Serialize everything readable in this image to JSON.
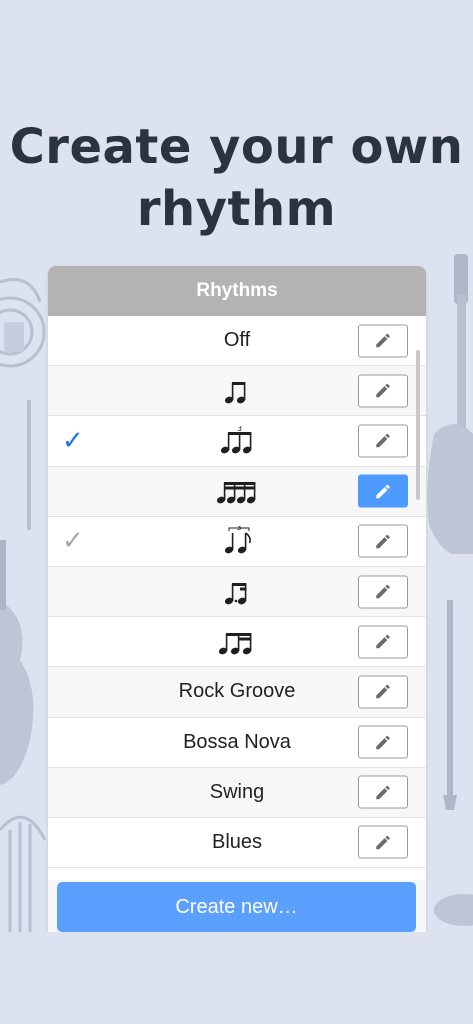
{
  "headline": "Create your own rhythm",
  "panel": {
    "title": "Rhythms"
  },
  "rhythms": [
    {
      "label": "Off",
      "icon": "none",
      "check": "",
      "edit_active": false
    },
    {
      "label": "",
      "icon": "two-eighth-notes",
      "check": "",
      "edit_active": false
    },
    {
      "label": "",
      "icon": "eighth-triplet",
      "check": "✓",
      "check_color": "#1a73e8",
      "edit_active": false
    },
    {
      "label": "",
      "icon": "four-sixteenth-notes",
      "check": "",
      "edit_active": true
    },
    {
      "label": "",
      "icon": "quarter-eighth-triplet",
      "check": "✓",
      "check_color": "#a8a8a8",
      "edit_active": false
    },
    {
      "label": "",
      "icon": "dotted-eighth-sixteenth",
      "check": "",
      "edit_active": false
    },
    {
      "label": "",
      "icon": "eighth-two-sixteenths",
      "check": "",
      "edit_active": false
    },
    {
      "label": "Rock Groove",
      "icon": "none",
      "check": "",
      "edit_active": false
    },
    {
      "label": "Bossa Nova",
      "icon": "none",
      "check": "",
      "edit_active": false
    },
    {
      "label": "Swing",
      "icon": "none",
      "check": "",
      "edit_active": false
    },
    {
      "label": "Blues",
      "icon": "none",
      "check": "",
      "edit_active": false
    }
  ],
  "triplet_number": "3",
  "create_button": "Create new…",
  "colors": {
    "background": "#dde2f0",
    "accent": "#5ba0ff",
    "header": "#b3b3b3",
    "check_primary": "#1a73e8",
    "check_secondary": "#a8a8a8"
  }
}
